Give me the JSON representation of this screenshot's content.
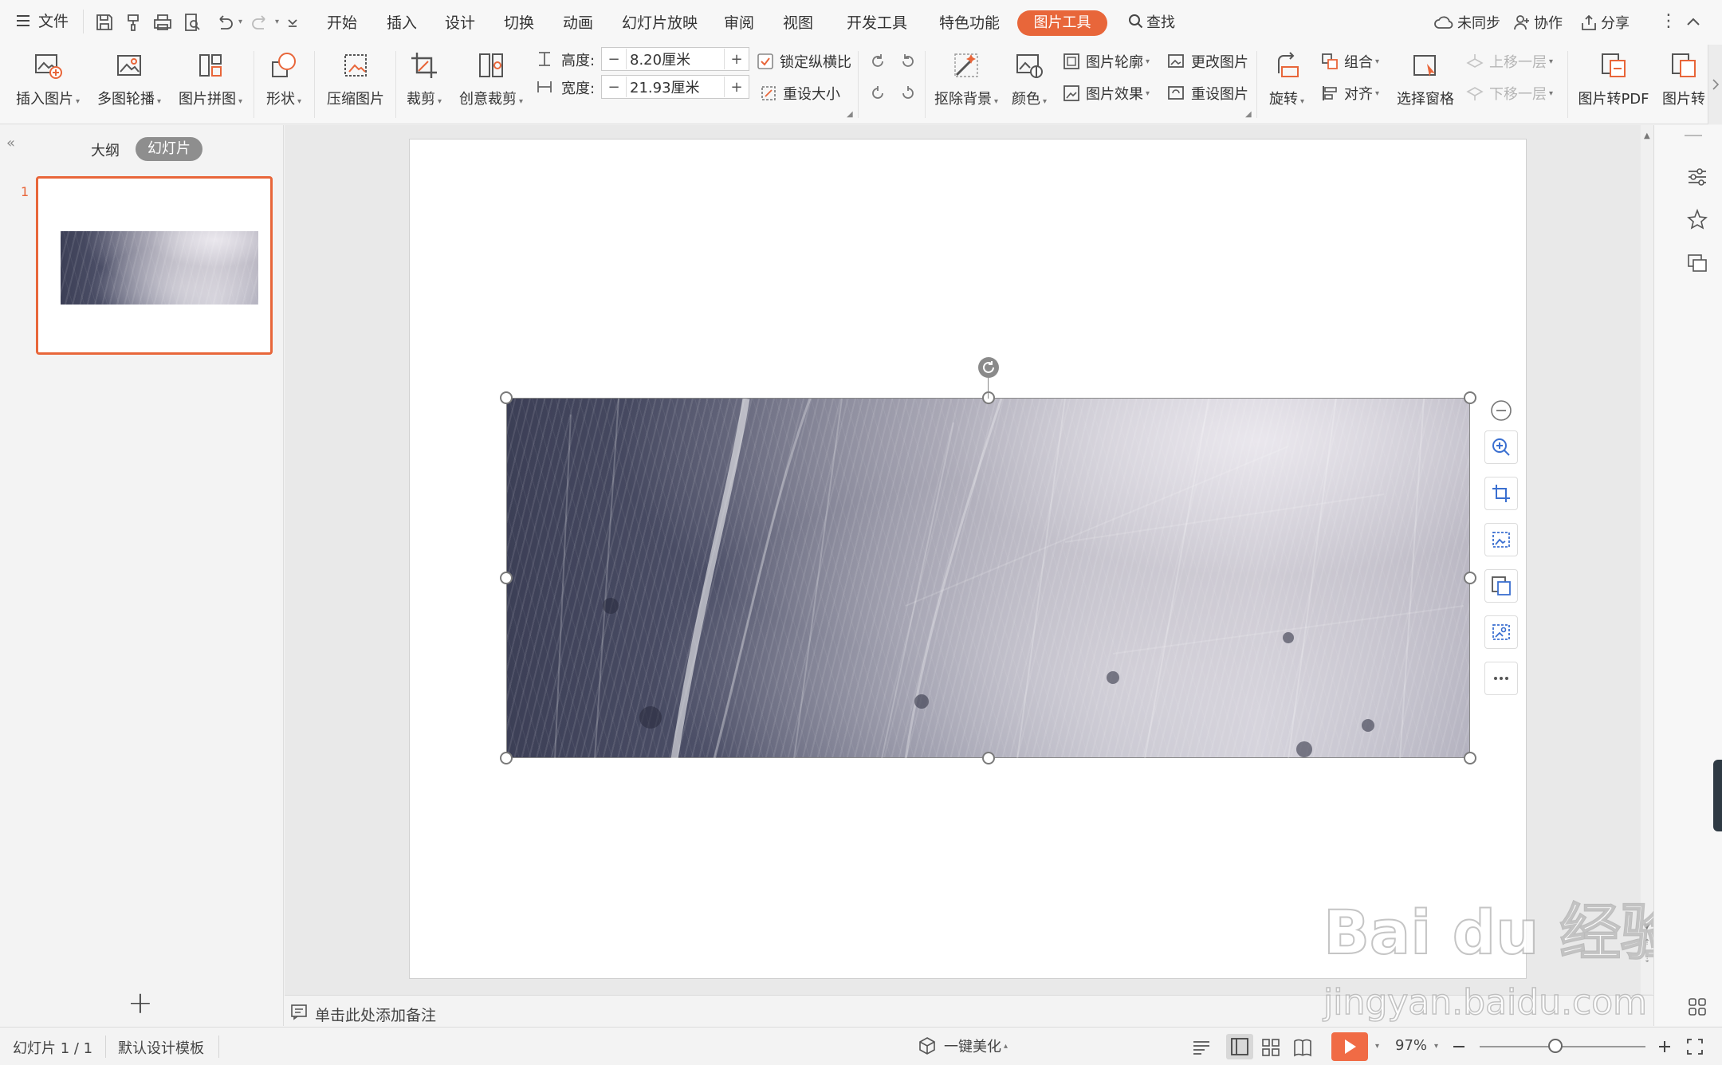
{
  "menubar": {
    "file_label": "文件",
    "tabs": [
      "开始",
      "插入",
      "设计",
      "切换",
      "动画",
      "幻灯片放映",
      "审阅",
      "视图",
      "开发工具",
      "特色功能"
    ],
    "active_tab": "图片工具",
    "search_label": "查找",
    "sync_label": "未同步",
    "collab_label": "协作",
    "share_label": "分享"
  },
  "ribbon": {
    "insert_picture": "插入图片",
    "multi_carousel": "多图轮播",
    "collage": "图片拼图",
    "shape": "形状",
    "compress": "压缩图片",
    "crop": "裁剪",
    "creative_crop": "创意裁剪",
    "height_label": "高度:",
    "height_value": "8.20厘米",
    "width_label": "宽度:",
    "width_value": "21.93厘米",
    "lock_ratio": "锁定纵横比",
    "reset_size": "重设大小",
    "remove_bg": "抠除背景",
    "color": "颜色",
    "outline": "图片轮廓",
    "effects": "图片效果",
    "change_picture": "更改图片",
    "reset_picture": "重设图片",
    "rotate": "旋转",
    "group": "组合",
    "align": "对齐",
    "selection_pane": "选择窗格",
    "bring_forward": "上移一层",
    "send_backward": "下移一层",
    "to_pdf": "图片转PDF",
    "convert": "图片转",
    "minus": "−",
    "plus": "+"
  },
  "left_panel": {
    "tab_outline": "大纲",
    "tab_slides": "幻灯片",
    "slide_number": "1",
    "add_symbol": "+"
  },
  "notes_placeholder": "单击此处添加备注",
  "status": {
    "slide_info": "幻灯片 1 / 1",
    "template": "默认设计模板",
    "beautify": "一键美化",
    "zoom": "97%"
  },
  "watermark": {
    "logo": "Bai du 经验",
    "url": "jingyan.baidu.com"
  },
  "colors": {
    "accent": "#e8663a",
    "selection_border": "#e8663a",
    "play_button": "#f06b45"
  }
}
